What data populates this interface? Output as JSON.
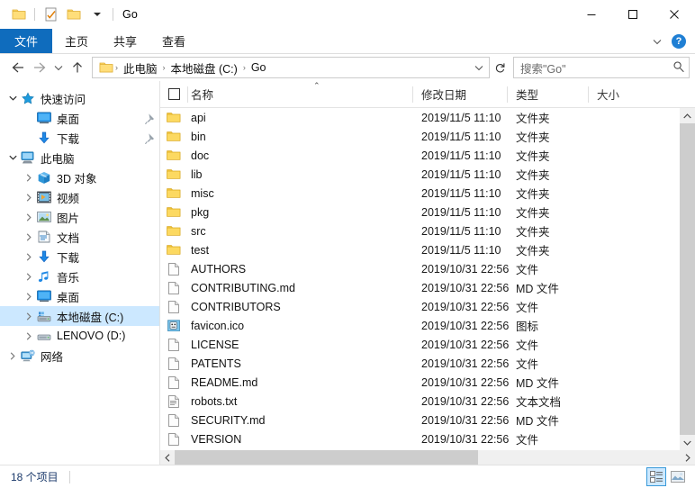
{
  "window": {
    "title": "Go",
    "quick_access": [
      {
        "name": "folder-icon",
        "label": ""
      },
      {
        "name": "properties-icon",
        "label": ""
      },
      {
        "name": "new-folder-icon",
        "label": ""
      },
      {
        "name": "chevron-down-icon",
        "label": ""
      }
    ],
    "controls": {
      "minimize": "—",
      "maximize": "□",
      "close": "✕"
    }
  },
  "ribbon": {
    "tabs": [
      {
        "label": "文件",
        "active": true
      },
      {
        "label": "主页",
        "active": false
      },
      {
        "label": "共享",
        "active": false
      },
      {
        "label": "查看",
        "active": false
      }
    ],
    "expand_caret": "⌄",
    "help_label": "?",
    "accent_color": "#0f6cbd"
  },
  "address_bar": {
    "back": "←",
    "forward": "→",
    "recent": "⌄",
    "up": "↑",
    "crumbs": [
      "此电脑",
      "本地磁盘 (C:)",
      "Go"
    ],
    "separator": "›",
    "dropdown_caret": "⌄",
    "refresh": "↻"
  },
  "search": {
    "placeholder": "搜索\"Go\"",
    "icon": "search-icon"
  },
  "sidebar": {
    "items": [
      {
        "label": "快速访问",
        "icon": "star-icon",
        "indent": 0,
        "twisty": "open",
        "pinned": false,
        "selected": false
      },
      {
        "label": "桌面",
        "icon": "desktop-icon",
        "indent": 1,
        "twisty": "none",
        "pinned": true,
        "selected": false
      },
      {
        "label": "下载",
        "icon": "download-icon",
        "indent": 1,
        "twisty": "none",
        "pinned": true,
        "selected": false
      },
      {
        "label": "此电脑",
        "icon": "computer-icon",
        "indent": 0,
        "twisty": "open",
        "pinned": false,
        "selected": false
      },
      {
        "label": "3D 对象",
        "icon": "3d-object-icon",
        "indent": 1,
        "twisty": "closed",
        "pinned": false,
        "selected": false
      },
      {
        "label": "视频",
        "icon": "video-icon",
        "indent": 1,
        "twisty": "closed",
        "pinned": false,
        "selected": false
      },
      {
        "label": "图片",
        "icon": "pictures-icon",
        "indent": 1,
        "twisty": "closed",
        "pinned": false,
        "selected": false
      },
      {
        "label": "文档",
        "icon": "documents-icon",
        "indent": 1,
        "twisty": "closed",
        "pinned": false,
        "selected": false
      },
      {
        "label": "下载",
        "icon": "download-icon",
        "indent": 1,
        "twisty": "closed",
        "pinned": false,
        "selected": false
      },
      {
        "label": "音乐",
        "icon": "music-icon",
        "indent": 1,
        "twisty": "closed",
        "pinned": false,
        "selected": false
      },
      {
        "label": "桌面",
        "icon": "desktop-icon",
        "indent": 1,
        "twisty": "closed",
        "pinned": false,
        "selected": false
      },
      {
        "label": "本地磁盘 (C:)",
        "icon": "local-disk-icon",
        "indent": 1,
        "twisty": "closed",
        "pinned": false,
        "selected": true
      },
      {
        "label": "LENOVO (D:)",
        "icon": "drive-icon",
        "indent": 1,
        "twisty": "closed",
        "pinned": false,
        "selected": false
      },
      {
        "label": "网络",
        "icon": "network-icon",
        "indent": 0,
        "twisty": "closed",
        "pinned": false,
        "selected": false
      }
    ]
  },
  "file_list": {
    "columns": [
      {
        "key": "name",
        "label": "名称",
        "sorted": "asc"
      },
      {
        "key": "date",
        "label": "修改日期",
        "sorted": ""
      },
      {
        "key": "type",
        "label": "类型",
        "sorted": ""
      },
      {
        "key": "size",
        "label": "大小",
        "sorted": ""
      }
    ],
    "sort_caret": "⌃",
    "rows": [
      {
        "name": "api",
        "date": "2019/11/5 11:10",
        "type": "文件夹",
        "size": "",
        "icon": "folder-icon"
      },
      {
        "name": "bin",
        "date": "2019/11/5 11:10",
        "type": "文件夹",
        "size": "",
        "icon": "folder-icon"
      },
      {
        "name": "doc",
        "date": "2019/11/5 11:10",
        "type": "文件夹",
        "size": "",
        "icon": "folder-icon"
      },
      {
        "name": "lib",
        "date": "2019/11/5 11:10",
        "type": "文件夹",
        "size": "",
        "icon": "folder-icon"
      },
      {
        "name": "misc",
        "date": "2019/11/5 11:10",
        "type": "文件夹",
        "size": "",
        "icon": "folder-icon"
      },
      {
        "name": "pkg",
        "date": "2019/11/5 11:10",
        "type": "文件夹",
        "size": "",
        "icon": "folder-icon"
      },
      {
        "name": "src",
        "date": "2019/11/5 11:10",
        "type": "文件夹",
        "size": "",
        "icon": "folder-icon"
      },
      {
        "name": "test",
        "date": "2019/11/5 11:10",
        "type": "文件夹",
        "size": "",
        "icon": "folder-icon"
      },
      {
        "name": "AUTHORS",
        "date": "2019/10/31 22:56",
        "type": "文件",
        "size": "",
        "icon": "file-icon"
      },
      {
        "name": "CONTRIBUTING.md",
        "date": "2019/10/31 22:56",
        "type": "MD 文件",
        "size": "",
        "icon": "file-icon"
      },
      {
        "name": "CONTRIBUTORS",
        "date": "2019/10/31 22:56",
        "type": "文件",
        "size": "",
        "icon": "file-icon"
      },
      {
        "name": "favicon.ico",
        "date": "2019/10/31 22:56",
        "type": "图标",
        "size": "",
        "icon": "ico-icon"
      },
      {
        "name": "LICENSE",
        "date": "2019/10/31 22:56",
        "type": "文件",
        "size": "",
        "icon": "file-icon"
      },
      {
        "name": "PATENTS",
        "date": "2019/10/31 22:56",
        "type": "文件",
        "size": "",
        "icon": "file-icon"
      },
      {
        "name": "README.md",
        "date": "2019/10/31 22:56",
        "type": "MD 文件",
        "size": "",
        "icon": "file-icon"
      },
      {
        "name": "robots.txt",
        "date": "2019/10/31 22:56",
        "type": "文本文档",
        "size": "",
        "icon": "text-icon"
      },
      {
        "name": "SECURITY.md",
        "date": "2019/10/31 22:56",
        "type": "MD 文件",
        "size": "",
        "icon": "file-icon"
      },
      {
        "name": "VERSION",
        "date": "2019/10/31 22:56",
        "type": "文件",
        "size": "",
        "icon": "file-icon"
      }
    ]
  },
  "status_bar": {
    "item_count": "18 个项目",
    "views": [
      {
        "name": "details-view-button",
        "active": true
      },
      {
        "name": "large-icons-view-button",
        "active": false
      }
    ]
  }
}
